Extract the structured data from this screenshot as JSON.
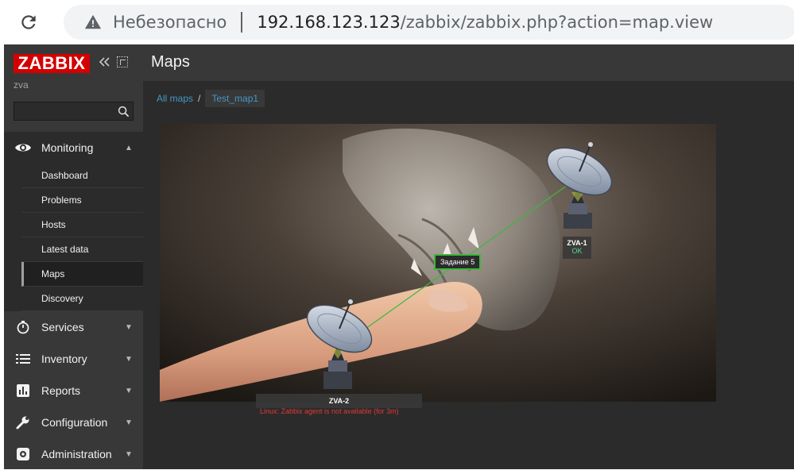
{
  "browser": {
    "insecure_label": "Небезопасно",
    "url_host": "192.168.123.123",
    "url_path": "/zabbix/zabbix.php?action=map.view"
  },
  "sidebar": {
    "logo": "ZABBIX",
    "server_name": "zva",
    "search_placeholder": "",
    "menu": [
      {
        "label": "Monitoring",
        "icon": "eye-icon",
        "expanded": true
      },
      {
        "label": "Services",
        "icon": "stopwatch-icon"
      },
      {
        "label": "Inventory",
        "icon": "list-icon"
      },
      {
        "label": "Reports",
        "icon": "bar-chart-icon"
      },
      {
        "label": "Configuration",
        "icon": "wrench-icon"
      },
      {
        "label": "Administration",
        "icon": "gear-icon"
      }
    ],
    "monitoring_items": [
      "Dashboard",
      "Problems",
      "Hosts",
      "Latest data",
      "Maps",
      "Discovery"
    ],
    "selected_item": "Maps"
  },
  "page": {
    "title": "Maps",
    "breadcrumb_root": "All maps",
    "breadcrumb_sep": "/",
    "breadcrumb_current": "Test_map1"
  },
  "map": {
    "link_label": "Задание 5",
    "hosts": [
      {
        "name": "ZVA-1",
        "status": "OK",
        "icon": "satellite-dish-icon"
      },
      {
        "name": "ZVA-2",
        "problem": "Linux: Zabbix agent is not available (for 3m)",
        "icon": "satellite-dish-icon"
      }
    ],
    "link_color": "#3db73d",
    "problem_color": "#e33734",
    "ok_color": "#59db8f"
  }
}
